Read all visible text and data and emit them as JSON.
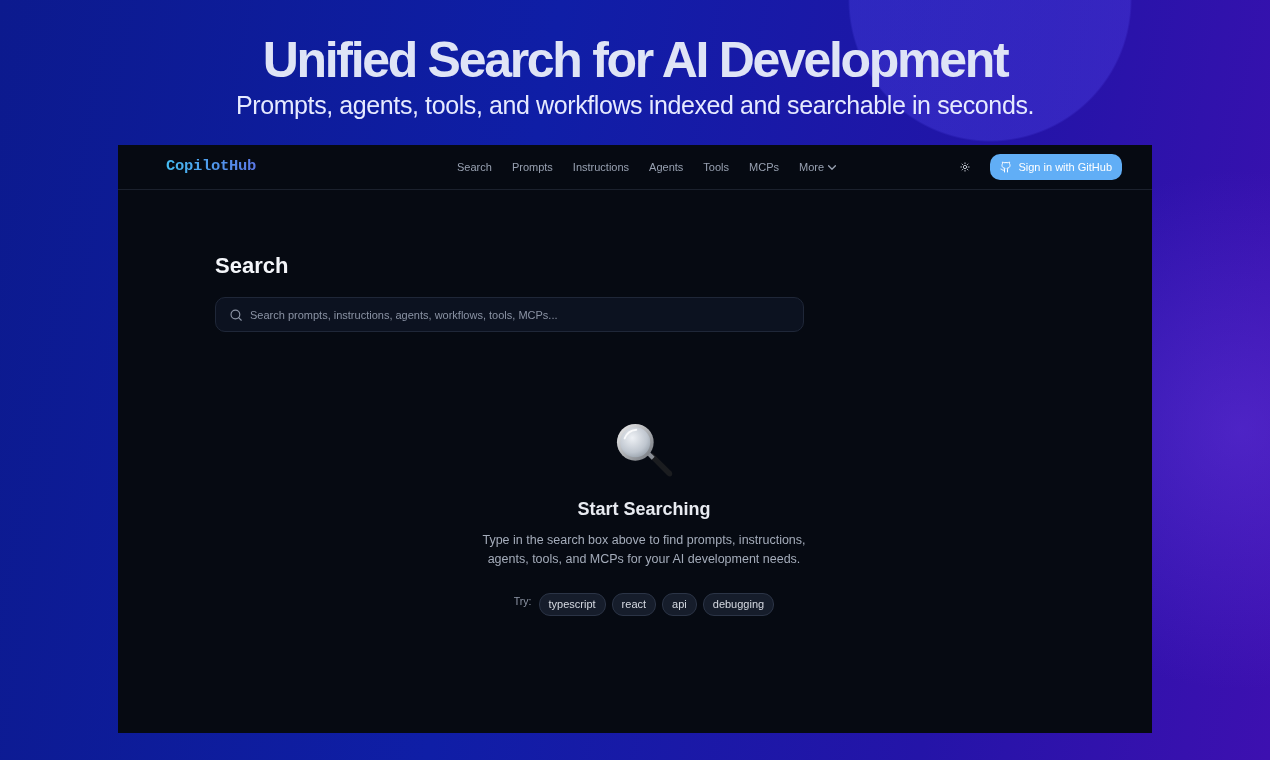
{
  "hero": {
    "title": "Unified Search for AI Development",
    "subtitle": "Prompts, agents, tools, and workflows indexed and searchable in seconds."
  },
  "navbar": {
    "logo": "CopilotHub",
    "links": [
      {
        "label": "Search",
        "kind": "link"
      },
      {
        "label": "Prompts",
        "kind": "link"
      },
      {
        "label": "Instructions",
        "kind": "link"
      },
      {
        "label": "Agents",
        "kind": "link"
      },
      {
        "label": "Tools",
        "kind": "link"
      },
      {
        "label": "MCPs",
        "kind": "link"
      },
      {
        "label": "More",
        "kind": "dropdown"
      }
    ],
    "sign_in_button": "Sign in with GitHub"
  },
  "page": {
    "heading": "Search",
    "search": {
      "placeholder": "Search prompts, instructions, agents, workflows, tools, MCPs..."
    },
    "empty_state": {
      "title": "Start Searching",
      "description": "Type in the search box above to find prompts, instructions, agents, tools, and MCPs for your AI development needs.",
      "try_label": "Try:",
      "suggestions": [
        "typescript",
        "react",
        "api",
        "debugging"
      ]
    }
  }
}
